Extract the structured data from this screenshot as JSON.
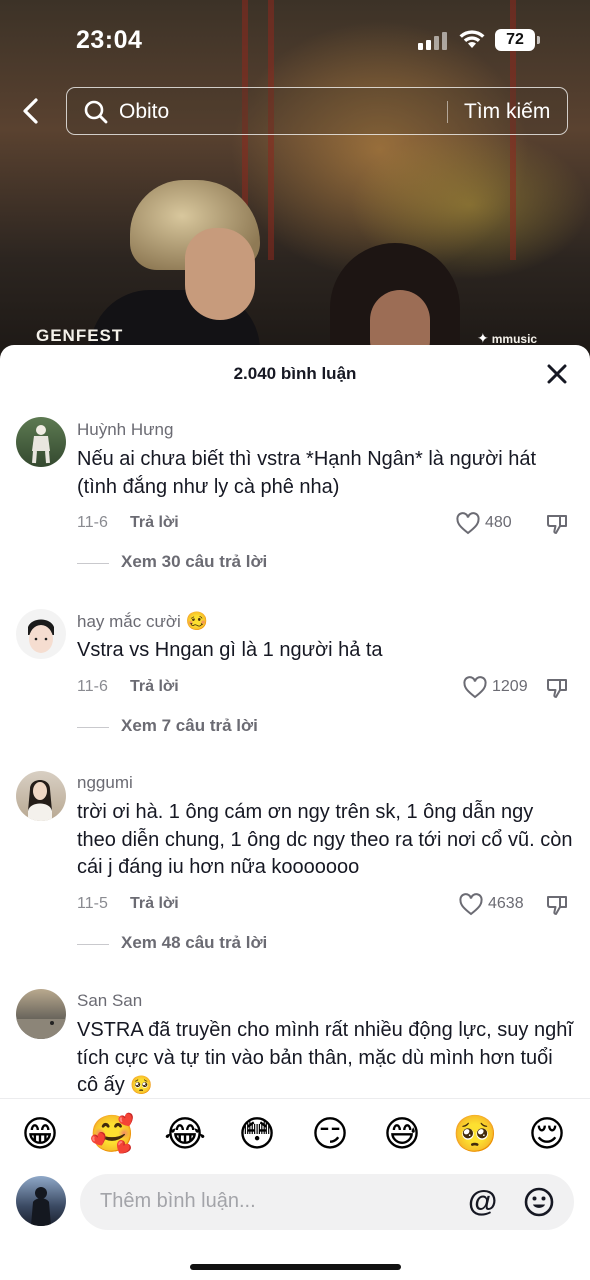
{
  "status_bar": {
    "time": "23:04",
    "battery": "72"
  },
  "search": {
    "query": "Obito",
    "button_label": "Tìm kiếm"
  },
  "video": {
    "logo_left": "GENFEST",
    "logo_right": "mmusic"
  },
  "comments_sheet": {
    "title": "2.040 bình luận",
    "comments": [
      {
        "username": "Huỳnh Hưng",
        "text": "Nếu ai chưa biết thì vstra *Hạnh Ngân* là người hát (tình đắng như ly cà phê nha)",
        "date": "11-6",
        "reply_label": "Trả lời",
        "likes": "480",
        "view_replies": "Xem 30 câu trả lời"
      },
      {
        "username": "hay mắc cười",
        "username_emoji": "🥴",
        "text": "Vstra vs Hngan gì là 1 người hả ta",
        "date": "11-6",
        "reply_label": "Trả lời",
        "likes": "1209",
        "view_replies": "Xem 7 câu trả lời"
      },
      {
        "username": "nggumi",
        "text": "trời ơi hà. 1 ông cám ơn ngy trên sk, 1 ông dẫn ngy theo diễn chung, 1 ông dc ngy theo ra tới nơi cổ vũ. còn cái j đáng iu hơn nữa kooooooo",
        "date": "11-5",
        "reply_label": "Trả lời",
        "likes": "4638",
        "view_replies": "Xem 48 câu trả lời"
      },
      {
        "username": "San San",
        "text": "VSTRA đã truyền cho mình rất nhiều động lực, suy nghĩ tích cực và tự tin vào bản thân, mặc dù mình hơn tuổi cô ấy",
        "text_emoji": "🥺"
      }
    ]
  },
  "emoji_bar": [
    "😁",
    "🥰",
    "😂",
    "😳",
    "😏",
    "😅",
    "🥺",
    "😌"
  ],
  "comment_input": {
    "placeholder": "Thêm bình luận...",
    "mention_symbol": "@"
  },
  "colors": {
    "text_primary": "#161823",
    "text_secondary": "#6b6b73",
    "input_bg": "#f1f1f2"
  }
}
